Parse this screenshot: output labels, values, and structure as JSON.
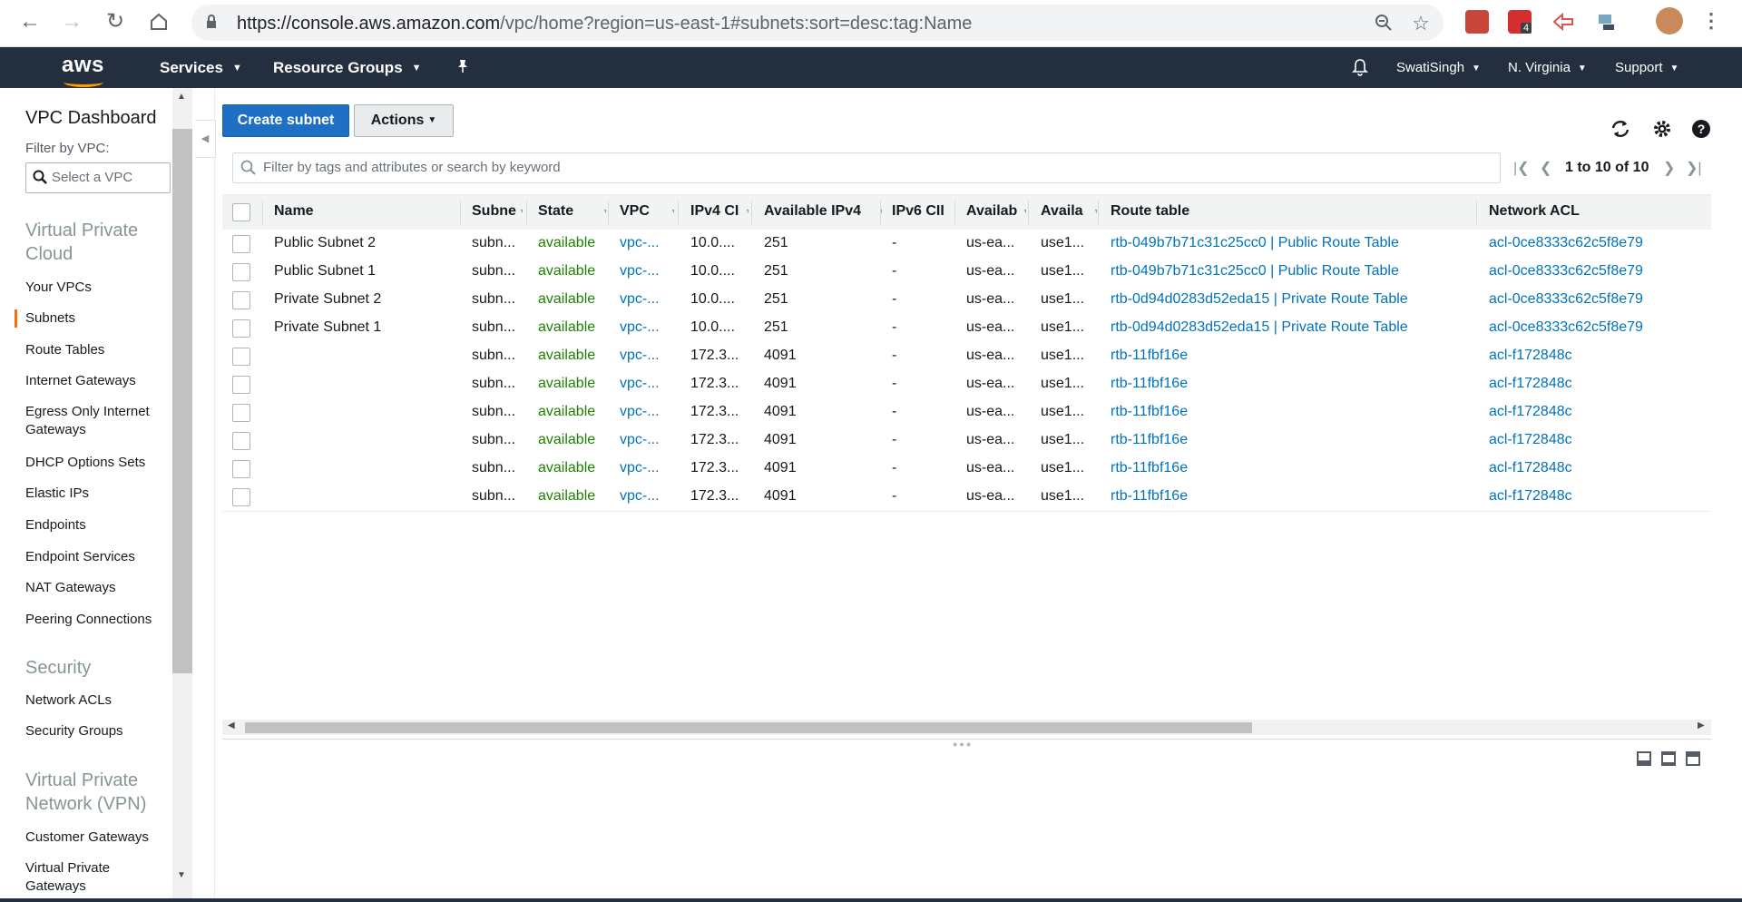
{
  "browser": {
    "url_host": "https://console.aws.amazon.com",
    "url_rest": "/vpc/home?region=us-east-1#subnets:sort=desc:tag:Name",
    "ext_badge": "4"
  },
  "aws_nav": {
    "logo": "aws",
    "services": "Services",
    "resource_groups": "Resource Groups",
    "user": "SwatiSingh",
    "region": "N. Virginia",
    "support": "Support"
  },
  "sidebar": {
    "title": "VPC Dashboard",
    "filter_label": "Filter by VPC:",
    "filter_placeholder": "Select a VPC",
    "section_vpc": "Virtual Private Cloud",
    "items_vpc": [
      "Your VPCs",
      "Subnets",
      "Route Tables",
      "Internet Gateways",
      "Egress Only Internet Gateways",
      "DHCP Options Sets",
      "Elastic IPs",
      "Endpoints",
      "Endpoint Services",
      "NAT Gateways",
      "Peering Connections"
    ],
    "section_security": "Security",
    "items_security": [
      "Network ACLs",
      "Security Groups"
    ],
    "section_vpn": "Virtual Private Network (VPN)",
    "items_vpn": [
      "Customer Gateways",
      "Virtual Private Gateways"
    ]
  },
  "toolbar": {
    "create_label": "Create subnet",
    "actions_label": "Actions"
  },
  "filter": {
    "placeholder": "Filter by tags and attributes or search by keyword",
    "pagination": "1 to 10 of 10"
  },
  "table": {
    "headers": [
      "Name",
      "Subne",
      "State",
      "VPC",
      "IPv4 CI",
      "Available IPv4",
      "IPv6 CII",
      "Availab",
      "Availa",
      "Route table",
      "Network ACL"
    ],
    "rows": [
      [
        "Public Subnet 2",
        "subn...",
        "available",
        "vpc-...",
        "10.0....",
        "251",
        "-",
        "us-ea...",
        "use1...",
        "rtb-049b7b71c31c25cc0 | Public Route Table",
        "acl-0ce8333c62c5f8e79"
      ],
      [
        "Public Subnet 1",
        "subn...",
        "available",
        "vpc-...",
        "10.0....",
        "251",
        "-",
        "us-ea...",
        "use1...",
        "rtb-049b7b71c31c25cc0 | Public Route Table",
        "acl-0ce8333c62c5f8e79"
      ],
      [
        "Private Subnet 2",
        "subn...",
        "available",
        "vpc-...",
        "10.0....",
        "251",
        "-",
        "us-ea...",
        "use1...",
        "rtb-0d94d0283d52eda15 | Private Route Table",
        "acl-0ce8333c62c5f8e79"
      ],
      [
        "Private Subnet 1",
        "subn...",
        "available",
        "vpc-...",
        "10.0....",
        "251",
        "-",
        "us-ea...",
        "use1...",
        "rtb-0d94d0283d52eda15 | Private Route Table",
        "acl-0ce8333c62c5f8e79"
      ],
      [
        "",
        "subn...",
        "available",
        "vpc-...",
        "172.3...",
        "4091",
        "-",
        "us-ea...",
        "use1...",
        "rtb-11fbf16e",
        "acl-f172848c"
      ],
      [
        "",
        "subn...",
        "available",
        "vpc-...",
        "172.3...",
        "4091",
        "-",
        "us-ea...",
        "use1...",
        "rtb-11fbf16e",
        "acl-f172848c"
      ],
      [
        "",
        "subn...",
        "available",
        "vpc-...",
        "172.3...",
        "4091",
        "-",
        "us-ea...",
        "use1...",
        "rtb-11fbf16e",
        "acl-f172848c"
      ],
      [
        "",
        "subn...",
        "available",
        "vpc-...",
        "172.3...",
        "4091",
        "-",
        "us-ea...",
        "use1...",
        "rtb-11fbf16e",
        "acl-f172848c"
      ],
      [
        "",
        "subn...",
        "available",
        "vpc-...",
        "172.3...",
        "4091",
        "-",
        "us-ea...",
        "use1...",
        "rtb-11fbf16e",
        "acl-f172848c"
      ],
      [
        "",
        "subn...",
        "available",
        "vpc-...",
        "172.3...",
        "4091",
        "-",
        "us-ea...",
        "use1...",
        "rtb-11fbf16e",
        "acl-f172848c"
      ]
    ]
  },
  "colors": {
    "aws_nav_bg": "#232f3e",
    "primary_button": "#1f6fc5",
    "status_green": "#1d8102",
    "link_blue": "#0073bb",
    "accent_orange": "#ff9900"
  }
}
